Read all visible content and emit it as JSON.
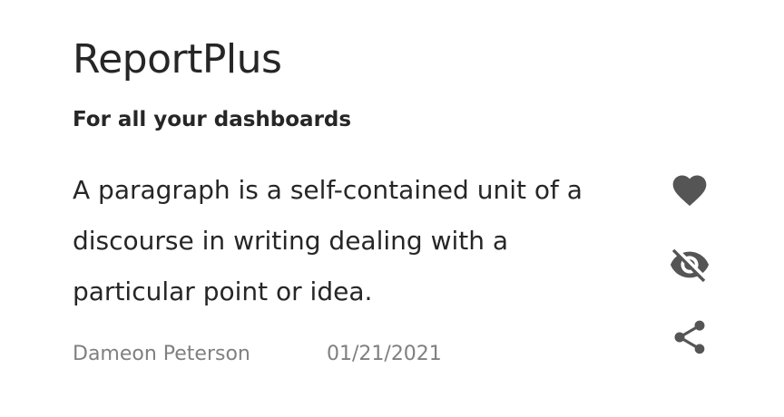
{
  "card": {
    "title": "ReportPlus",
    "subtitle": "For all your dashboards",
    "body": "A paragraph is a self-contained unit of a discourse in writing dealing with a particular point or idea.",
    "author": "Dameon Peterson",
    "date": "01/21/2021"
  },
  "actions": [
    {
      "icon": "heart-icon"
    },
    {
      "icon": "eye-off-icon"
    },
    {
      "icon": "share-icon"
    }
  ],
  "colors": {
    "text": "#262626",
    "muted": "#808080",
    "icon": "#555555",
    "background": "#ffffff"
  }
}
